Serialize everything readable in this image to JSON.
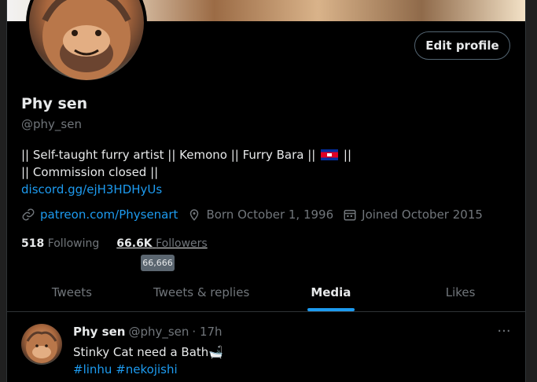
{
  "profile": {
    "edit_label": "Edit profile",
    "name": "Phy sen",
    "handle": "@phy_sen",
    "bio_line1_a": "|| Self-taught furry artist || Kemono || Furry Bara ||",
    "bio_line1_b": "||",
    "bio_line2": "|| Commission closed ||",
    "bio_link": "discord.gg/ejH3HDHyUs",
    "website": "patreon.com/Physenart",
    "born": "Born October 1, 1996",
    "joined": "Joined October 2015",
    "following_count": "518",
    "following_label": "Following",
    "followers_count": "66.6K",
    "followers_label": "Followers",
    "followers_tooltip": "66,666"
  },
  "tabs": [
    {
      "label": "Tweets"
    },
    {
      "label": "Tweets & replies"
    },
    {
      "label": "Media"
    },
    {
      "label": "Likes"
    }
  ],
  "tweet": {
    "name": "Phy sen",
    "handle": "@phy_sen",
    "time": "· 17h",
    "text": "Stinky Cat need a Bath🛁",
    "tags": "#linhu #nekojishi",
    "more": "···"
  },
  "colors": {
    "accent": "#1d9bf0",
    "background": "#000000",
    "muted": "#71767b"
  },
  "icons": {
    "website": "link-icon",
    "born": "location-pin-icon",
    "joined": "calendar-icon",
    "more": "more-dots-icon",
    "flag": "cambodia-flag-icon"
  }
}
